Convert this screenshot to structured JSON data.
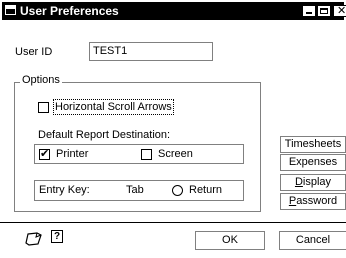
{
  "window": {
    "title": "User Preferences"
  },
  "user": {
    "id_label": "User ID",
    "id_value": "TEST1"
  },
  "options": {
    "legend": "Options",
    "horizontal_scroll_label": "Horizontal Scroll Arrows",
    "horizontal_scroll_checked": false,
    "report_destination_label": "Default Report Destination:",
    "printer_label": "Printer",
    "printer_checked": true,
    "screen_label": "Screen",
    "screen_checked": false,
    "entry_key_label": "Entry Key:",
    "tab_label": "Tab",
    "return_label": "Return"
  },
  "side_buttons": {
    "timesheets": "Timesheets",
    "expenses": "Expenses",
    "display_first": "D",
    "display_rest": "isplay",
    "password_first": "P",
    "password_rest": "assword"
  },
  "footer": {
    "ok_label": "OK",
    "cancel_label": "Cancel",
    "help_glyph": "?"
  }
}
